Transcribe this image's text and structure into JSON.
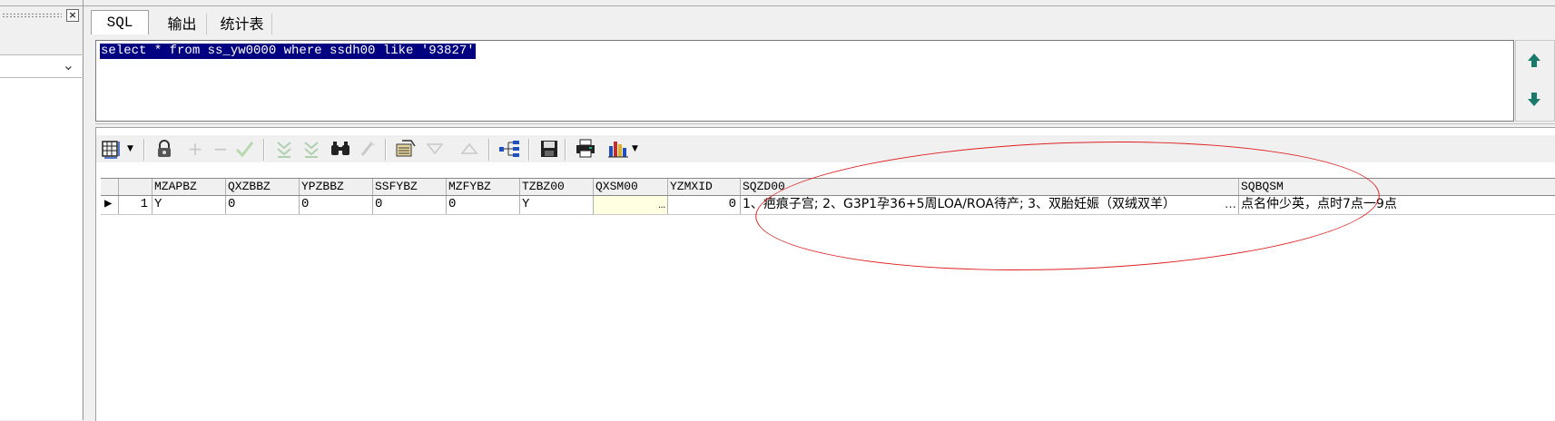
{
  "tabs": [
    {
      "label": "SQL",
      "active": true
    },
    {
      "label": "输出",
      "active": false
    },
    {
      "label": "统计表",
      "active": false
    }
  ],
  "sql": {
    "query": "select * from ss_yw0000 where ssdh00 like '93827'"
  },
  "toolbar": {
    "items": [
      "grid-layout-icon",
      "lock-icon",
      "plus-icon",
      "minus-icon",
      "check-icon",
      "filter-down-icon",
      "filter-down-all-icon",
      "binoculars-icon",
      "clear-icon",
      "import-icon",
      "triangle-down-icon",
      "triangle-up-icon",
      "tree-icon",
      "save-icon",
      "print-icon",
      "chart-icon"
    ]
  },
  "grid": {
    "columns": [
      "MZAPBZ",
      "QXZBBZ",
      "YPZBBZ",
      "SSFYBZ",
      "MZFYBZ",
      "TZBZ00",
      "QXSM00",
      "YZMXID",
      "SQZD00",
      "SQBQSM"
    ],
    "row": {
      "index": "1",
      "cells": [
        "Y",
        "0",
        "0",
        "0",
        "0",
        "Y",
        "",
        "0",
        "1、疤痕子宫; 2、G3P1孕36+5周LOA/ROA待产; 3、双胎妊娠（双绒双羊）",
        "点名仲少英，点时7点一9点"
      ],
      "ellipsis": "…"
    }
  },
  "colors": {
    "selection": "#000080",
    "annotation": "#e02020",
    "arrow": "#1a7a6a"
  }
}
